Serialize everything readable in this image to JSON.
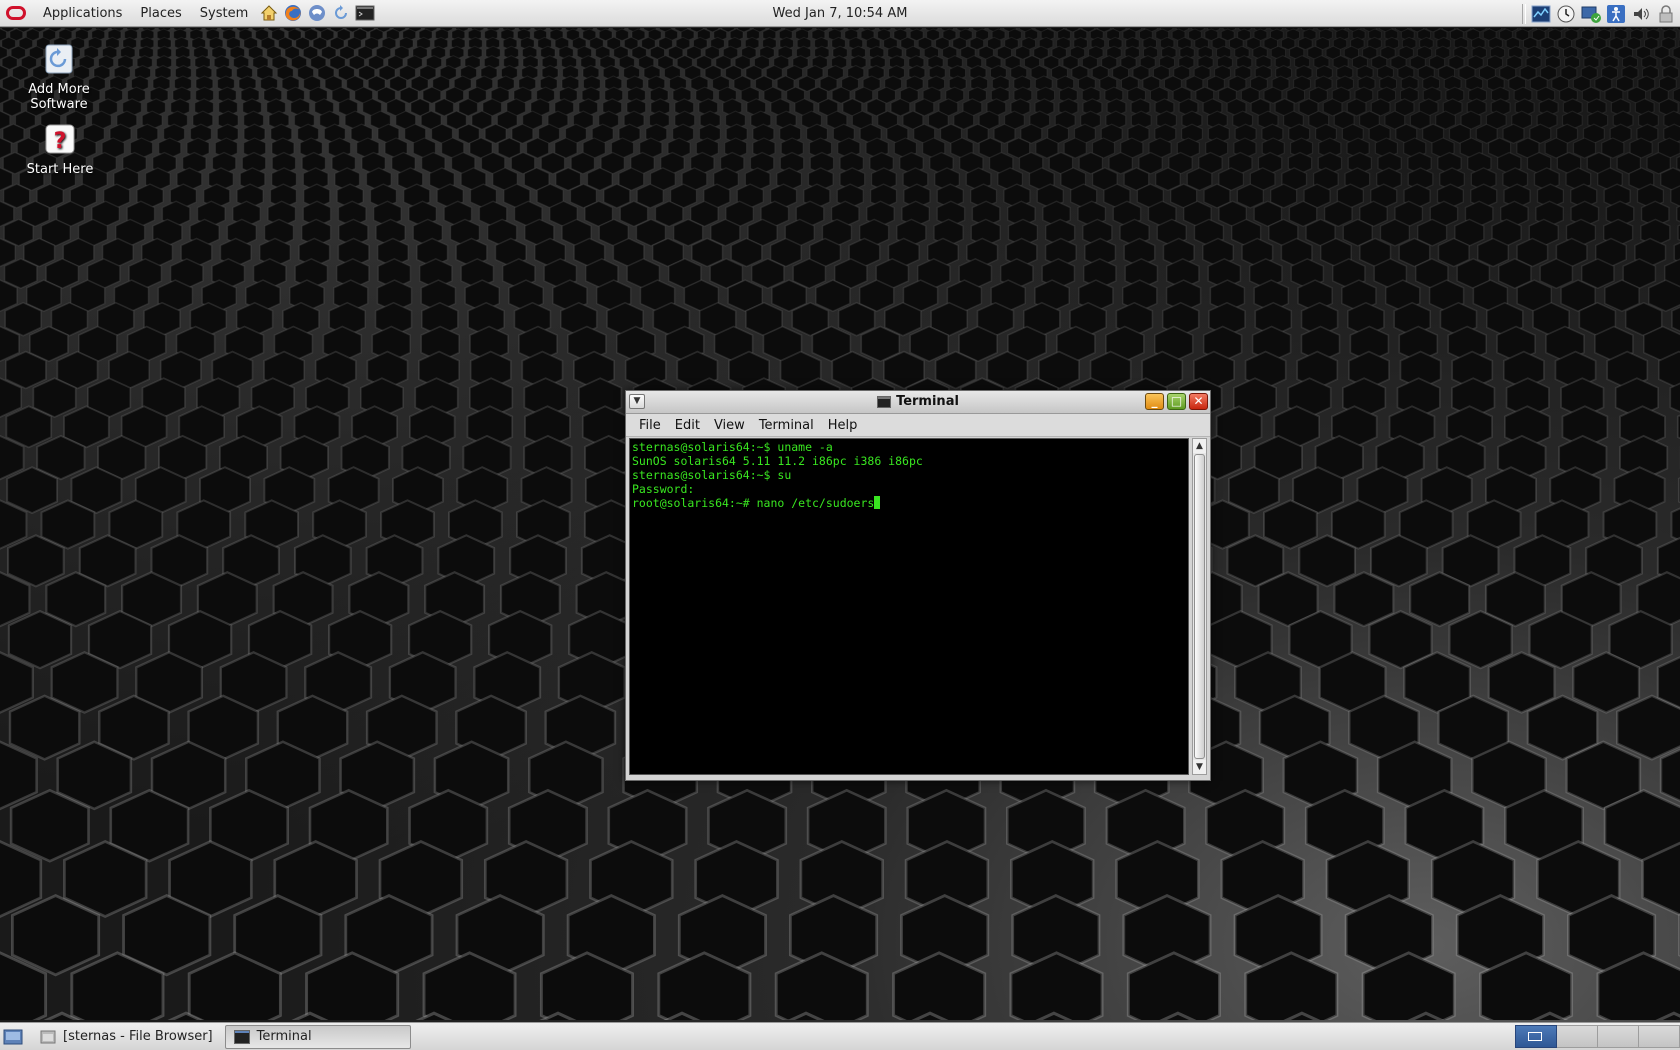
{
  "top_panel": {
    "menus": [
      "Applications",
      "Places",
      "System"
    ],
    "launchers": [
      "home-icon",
      "firefox-icon",
      "mail-icon",
      "update-icon",
      "terminal-icon"
    ],
    "clock": "Wed Jan  7, 10:54 AM",
    "tray": [
      "system-monitor-icon",
      "clock-icon",
      "network-icon",
      "accessibility-icon",
      "volume-icon",
      "lock-icon"
    ]
  },
  "desktop_icons": [
    {
      "label_line1": "Add More",
      "label_line2": "Software",
      "icon": "package-add-icon"
    },
    {
      "label_line1": "Start Here",
      "label_line2": "",
      "icon": "help-icon"
    }
  ],
  "terminal": {
    "title": "Terminal",
    "menu": [
      "File",
      "Edit",
      "View",
      "Terminal",
      "Help"
    ],
    "lines": [
      "sternas@solaris64:~$ uname -a",
      "SunOS solaris64 5.11 11.2 i86pc i386 i86pc",
      "sternas@solaris64:~$ su",
      "Password:",
      "root@solaris64:~# nano /etc/sudoers"
    ],
    "text_color": "#39e620",
    "background": "#000000"
  },
  "taskbar": {
    "items": [
      {
        "label": "[sternas - File Browser]",
        "active": false
      },
      {
        "label": "Terminal",
        "active": true
      }
    ],
    "workspace_count": 4
  }
}
